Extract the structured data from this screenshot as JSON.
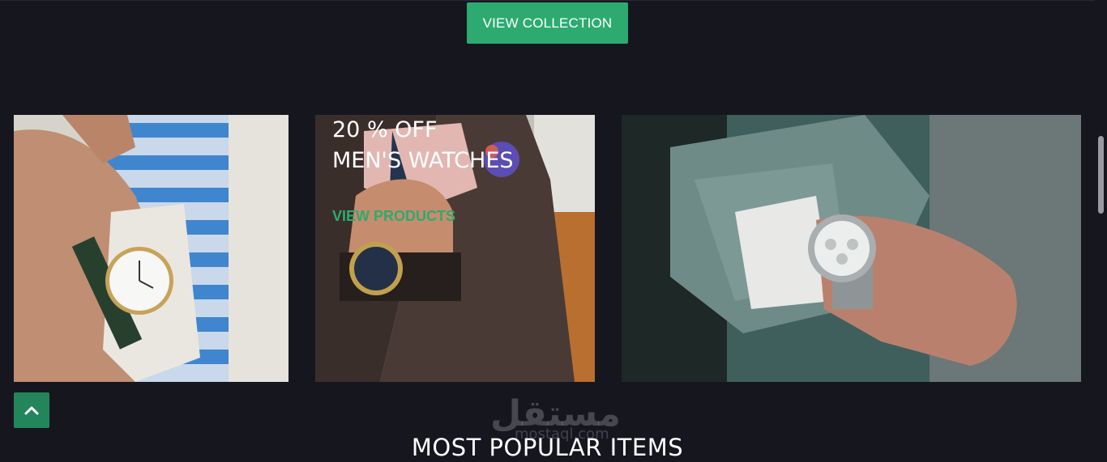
{
  "collection_button": {
    "label": "VIEW COLLECTION"
  },
  "promo": {
    "title_line1": "20 % OFF",
    "title_line2": "MEN'S WATCHES",
    "link_label": "VIEW PRODUCTS"
  },
  "section": {
    "heading": "MOST POPULAR ITEMS"
  },
  "watermark": {
    "text": "مستقل",
    "sub": "mostaql.com"
  },
  "icons": {
    "back_to_top": "chevron-up-icon"
  },
  "colors": {
    "accent": "#2daa70",
    "background": "#16161f",
    "back_to_top": "#23855a"
  }
}
